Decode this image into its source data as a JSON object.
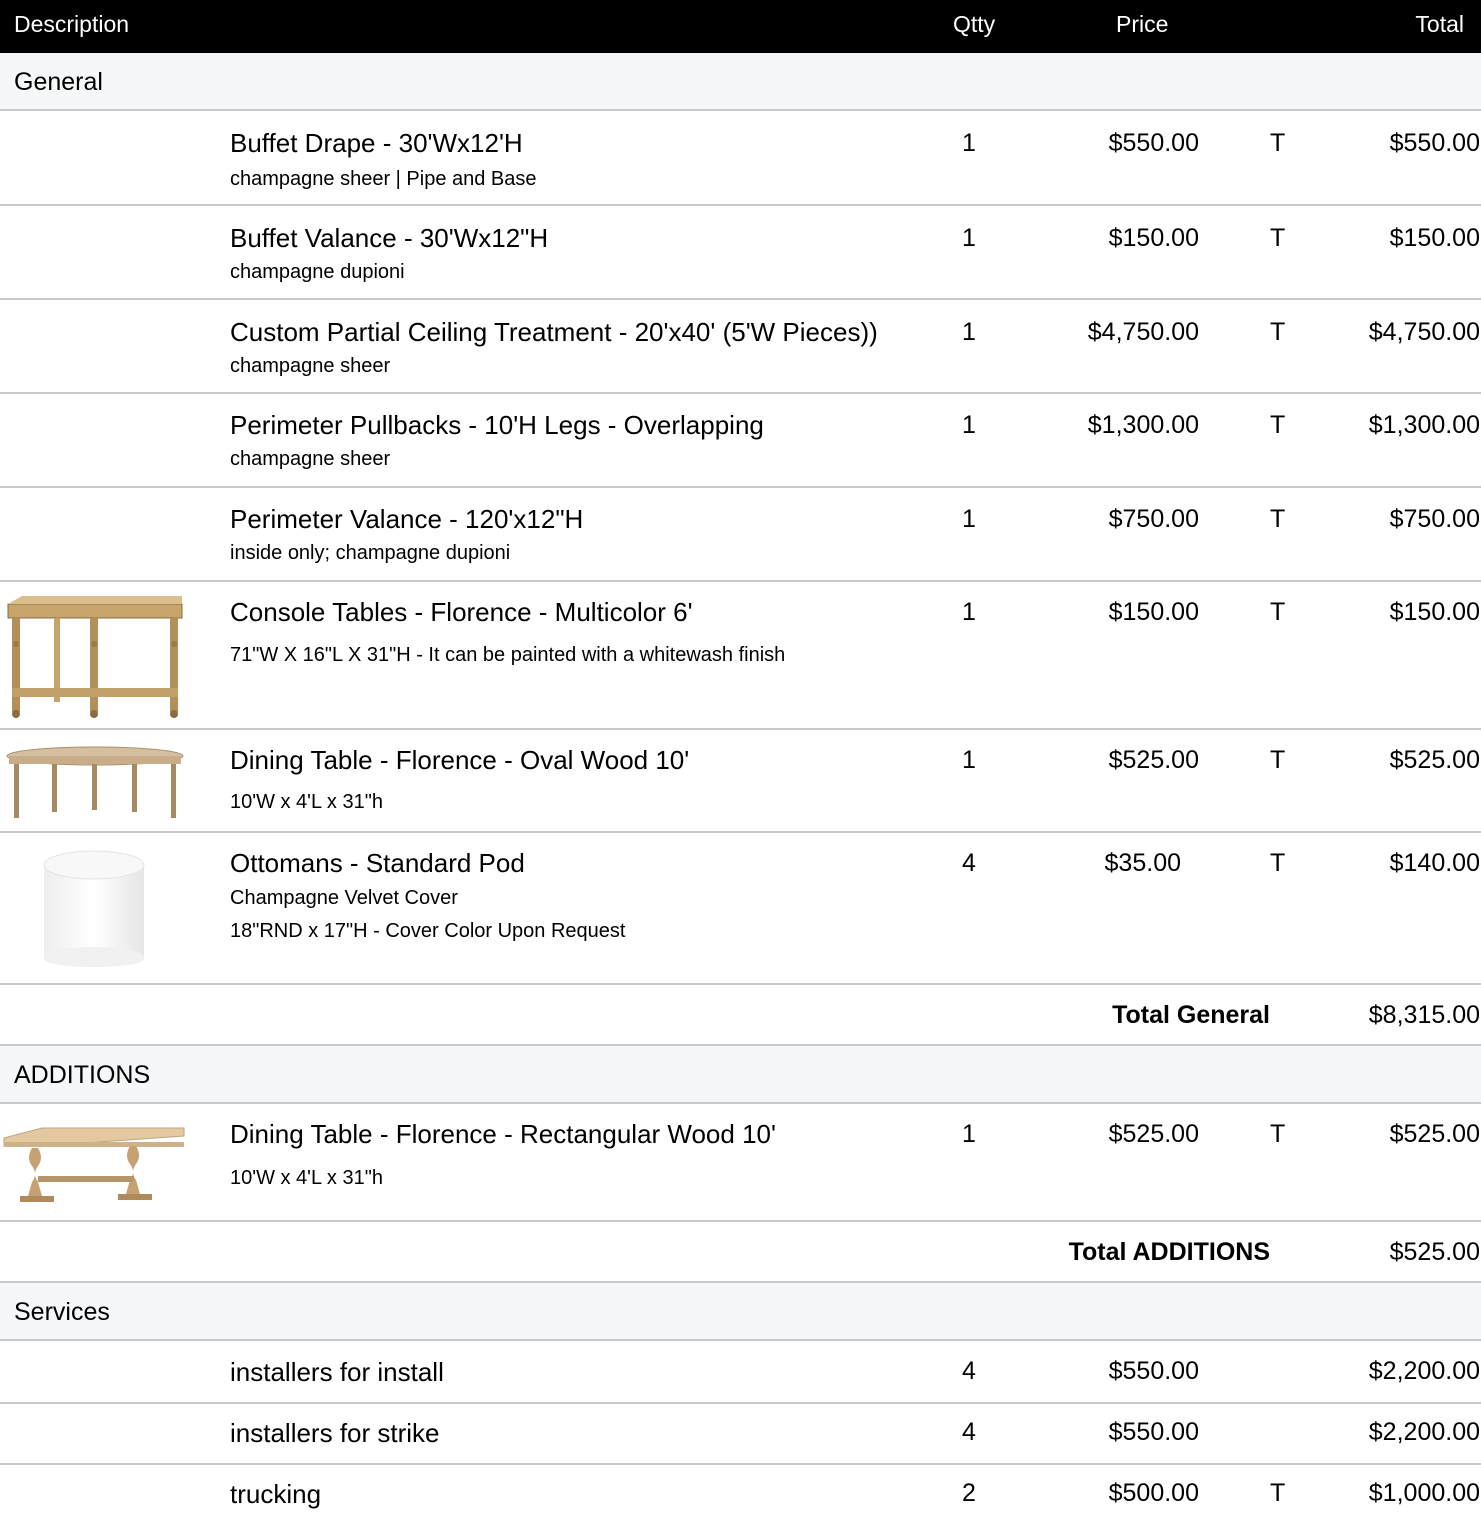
{
  "header": {
    "description": "Description",
    "qty": "Qtty",
    "price": "Price",
    "total": "Total"
  },
  "sections": [
    {
      "name": "General",
      "items": [
        {
          "title": "Buffet Drape - 30'Wx12'H",
          "sub1": "champagne sheer | Pipe and Base",
          "sub2": "",
          "qty": "1",
          "price": "$550.00",
          "tax": "T",
          "total": "$550.00",
          "image": ""
        },
        {
          "title": "Buffet Valance - 30'Wx12\"H",
          "sub1": "champagne dupioni",
          "sub2": "",
          "qty": "1",
          "price": "$150.00",
          "tax": "T",
          "total": "$150.00",
          "image": ""
        },
        {
          "title": "Custom Partial Ceiling Treatment - 20'x40' (5'W Pieces))",
          "sub1": "champagne sheer",
          "sub2": "",
          "qty": "1",
          "price": "$4,750.00",
          "tax": "T",
          "total": "$4,750.00",
          "image": ""
        },
        {
          "title": "Perimeter Pullbacks - 10'H Legs - Overlapping",
          "sub1": "champagne sheer",
          "sub2": "",
          "qty": "1",
          "price": "$1,300.00",
          "tax": "T",
          "total": "$1,300.00",
          "image": ""
        },
        {
          "title": "Perimeter Valance - 120'x12\"H",
          "sub1": "inside only; champagne dupioni",
          "sub2": "",
          "qty": "1",
          "price": "$750.00",
          "tax": "T",
          "total": "$750.00",
          "image": ""
        },
        {
          "title": "Console Tables - Florence - Multicolor 6'",
          "sub1": "71\"W X 16\"L X 31\"H - It can be painted with a whitewash finish",
          "sub2": "",
          "qty": "1",
          "price": "$150.00",
          "tax": "T",
          "total": "$150.00",
          "image": "console-table"
        },
        {
          "title": "Dining Table - Florence - Oval Wood 10'",
          "sub1": "10'W x 4'L x 31\"h",
          "sub2": "",
          "qty": "1",
          "price": "$525.00",
          "tax": "T",
          "total": "$525.00",
          "image": "oval-table"
        },
        {
          "title": "Ottomans - Standard Pod",
          "sub1": "Champagne Velvet Cover",
          "sub2": "18\"RND x 17\"H - Cover Color Upon Request",
          "qty": "4",
          "price": "$35.00",
          "tax": "T",
          "total": "$140.00",
          "image": "ottoman"
        }
      ],
      "subtotal_label": "Total General",
      "subtotal": "$8,315.00"
    },
    {
      "name": "ADDITIONS",
      "items": [
        {
          "title": "Dining Table - Florence - Rectangular Wood 10'",
          "sub1": "10'W x 4'L x 31\"h",
          "sub2": "",
          "qty": "1",
          "price": "$525.00",
          "tax": "T",
          "total": "$525.00",
          "image": "rect-table"
        }
      ],
      "subtotal_label": "Total ADDITIONS",
      "subtotal": "$525.00"
    },
    {
      "name": "Services",
      "items": [
        {
          "title": "installers for install",
          "sub1": "",
          "sub2": "",
          "qty": "4",
          "price": "$550.00",
          "tax": "",
          "total": "$2,200.00",
          "image": ""
        },
        {
          "title": "installers for strike",
          "sub1": "",
          "sub2": "",
          "qty": "4",
          "price": "$550.00",
          "tax": "",
          "total": "$2,200.00",
          "image": ""
        },
        {
          "title": "trucking",
          "sub1": "",
          "sub2": "",
          "qty": "2",
          "price": "$500.00",
          "tax": "T",
          "total": "$1,000.00",
          "image": ""
        }
      ]
    }
  ],
  "colors": {
    "header_bg": "#000000",
    "section_bg": "#f6f7f8",
    "divider": "#c9c9c9",
    "wood": "#c9a56e"
  }
}
